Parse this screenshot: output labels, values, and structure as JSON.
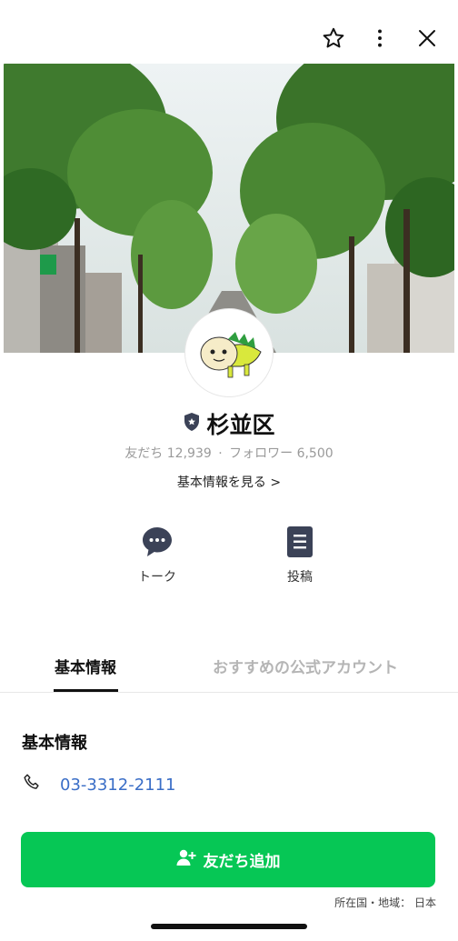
{
  "topbar": {
    "icons": [
      "star-outline-icon",
      "more-vertical-icon",
      "close-icon"
    ]
  },
  "cover": {
    "image": "tree-lined-street-photo"
  },
  "profile": {
    "name": "杉並区",
    "badge_icon": "verified-shield-icon",
    "friends_label": "友だち",
    "friends_count": "12,939",
    "separator": "·",
    "followers_label": "フォロワー",
    "followers_count": "6,500",
    "info_link": "基本情報を見る >"
  },
  "actions": [
    {
      "label": "トーク",
      "icon": "chat-bubble-icon"
    },
    {
      "label": "投稿",
      "icon": "post-list-icon"
    }
  ],
  "tabs": {
    "active": "基本情報",
    "inactive": "おすすめの公式アカウント"
  },
  "basic_info": {
    "title": "基本情報",
    "phone": "03-3312-2111"
  },
  "add_friend": {
    "label": "友だち追加"
  },
  "footer": {
    "country_label": "所在国・地域：",
    "country": "日本"
  },
  "colors": {
    "primary_green": "#06c755",
    "link_blue": "#3a6ec7",
    "badge_navy": "#3b4257"
  }
}
